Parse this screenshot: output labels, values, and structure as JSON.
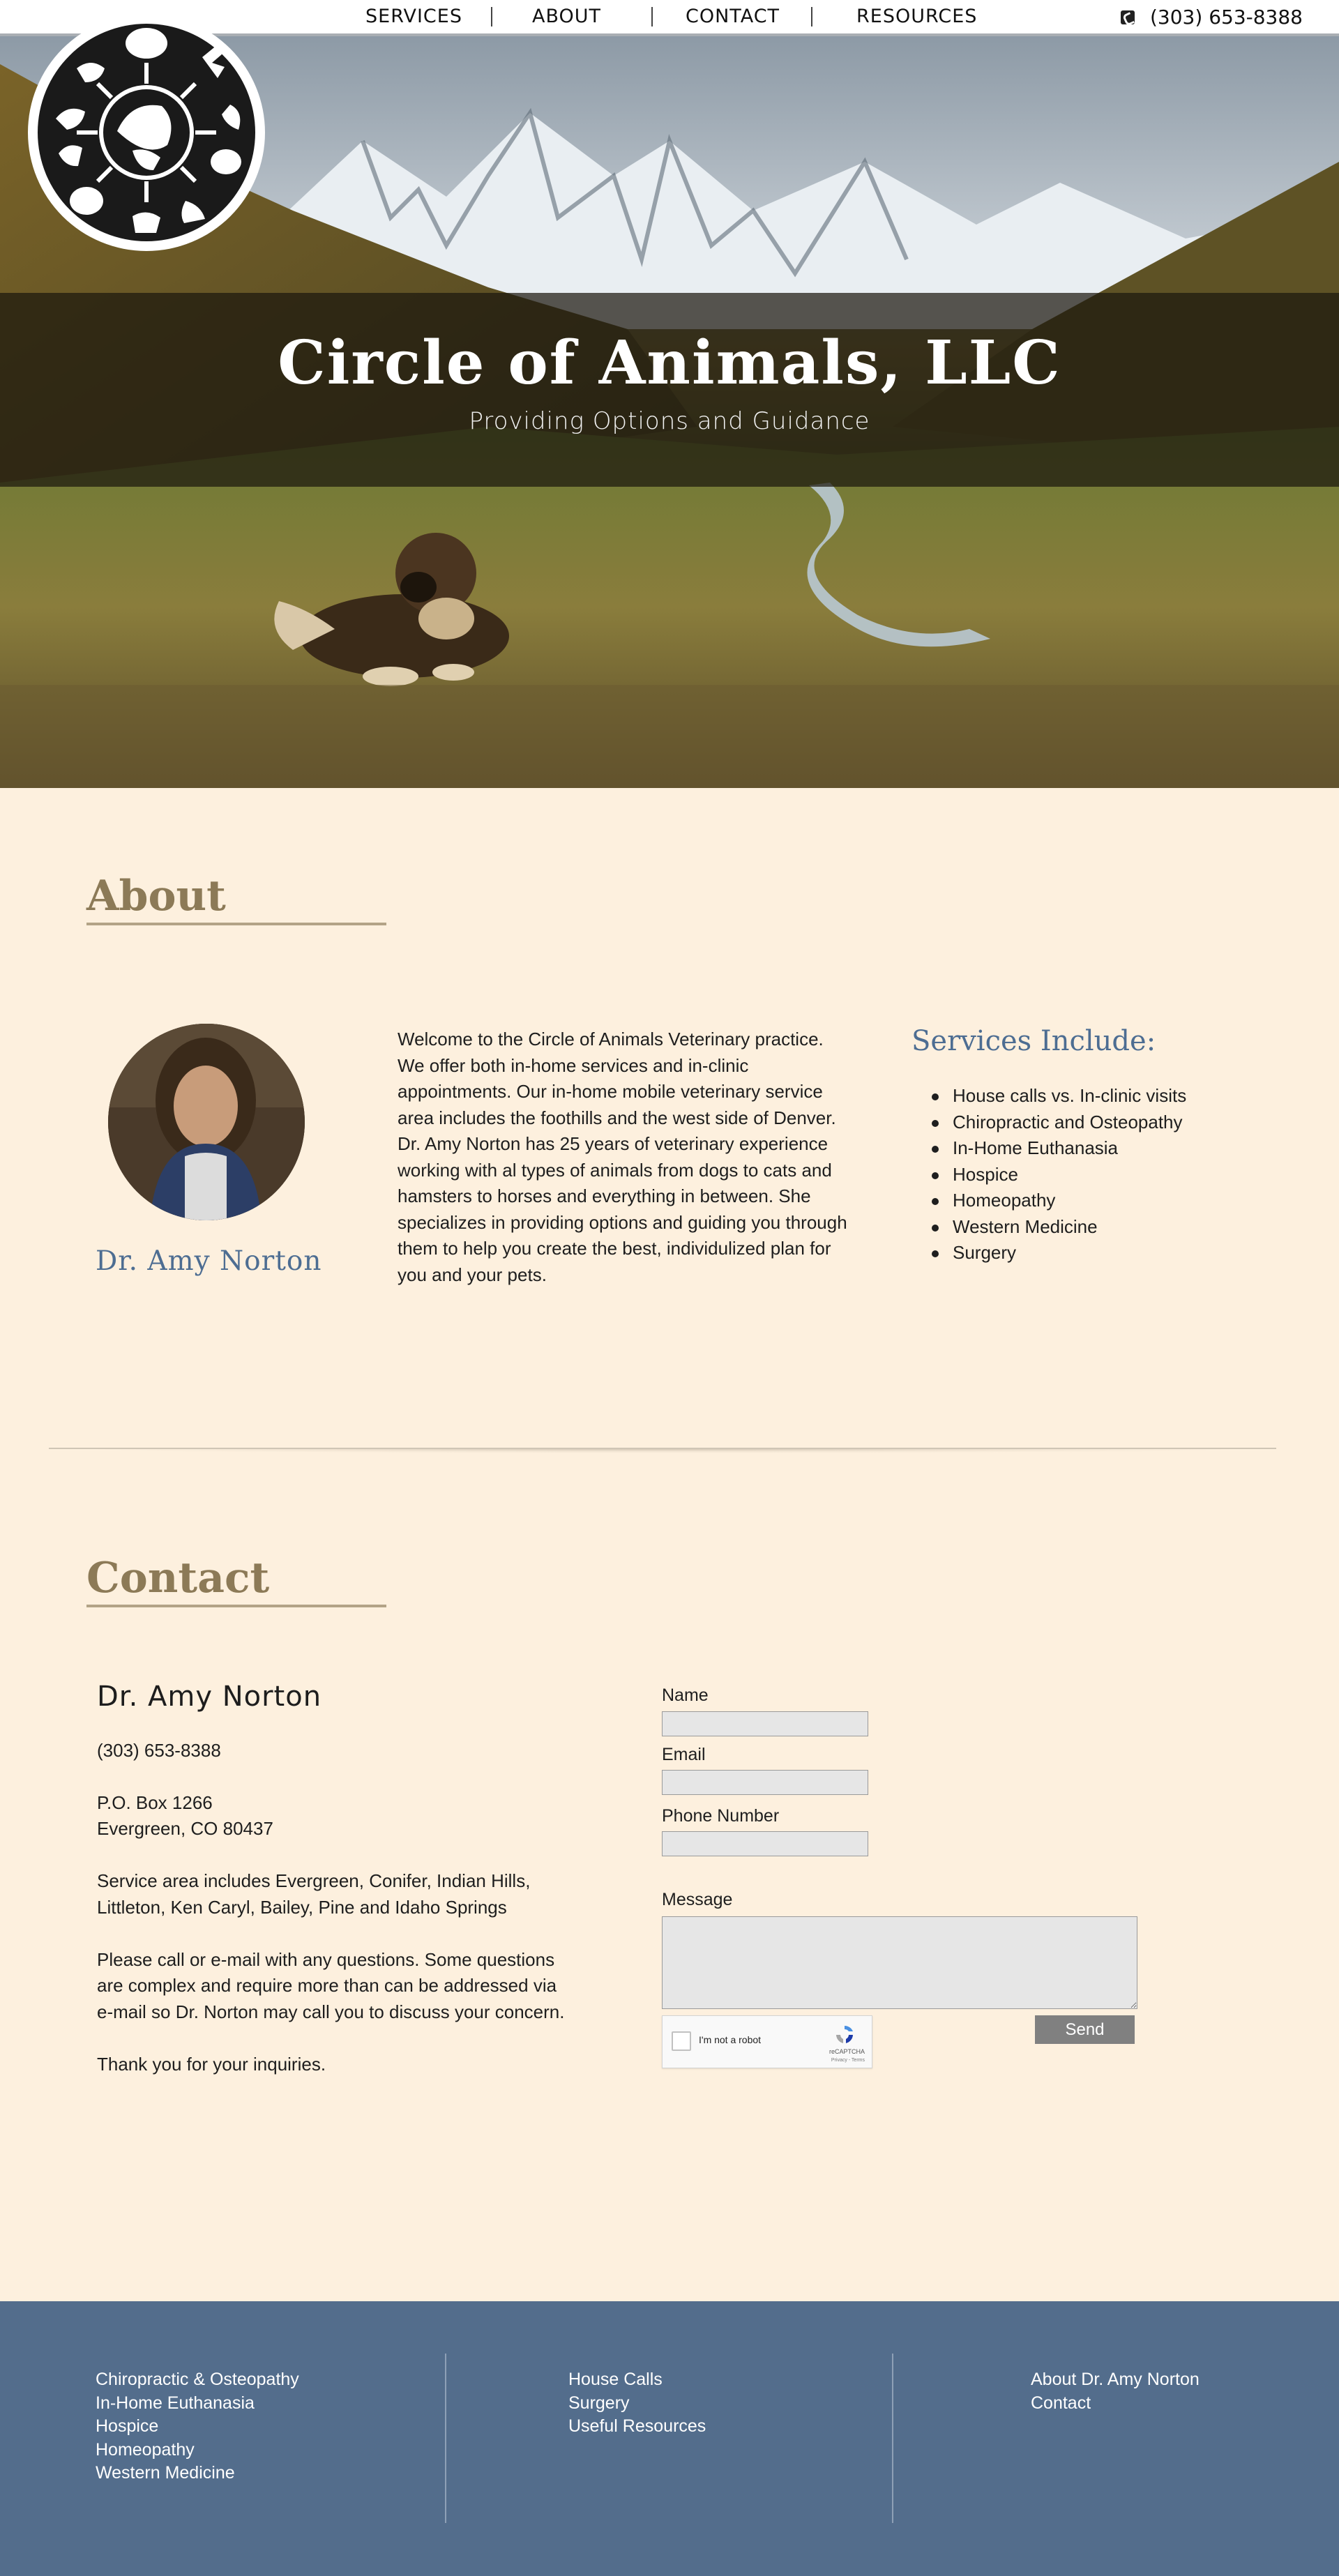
{
  "nav": {
    "items": [
      "SERVICES",
      "ABOUT",
      "CONTACT",
      "RESOURCES"
    ],
    "phone": "(303) 653-8388"
  },
  "hero": {
    "title": "Circle of Animals, LLC",
    "subtitle": "Providing Options and Guidance"
  },
  "about": {
    "heading": "About",
    "doctor_name": "Dr. Amy Norton",
    "intro_lines": [
      "Welcome to the Circle of Animals Veterinary practice.",
      "We offer both in-home services and in-clinic",
      "appointments. Our in-home mobile veterinary service",
      "area includes the foothills and the west side of Denver.",
      "Dr. Amy Norton has 25 years of veterinary experience",
      "working with al types of animals from dogs to cats and",
      "hamsters to horses and everything in between. She",
      "specializes in providing options and guiding you through",
      "them to help you create the best, individulized plan for",
      "you and your pets."
    ],
    "services_title": "Services Include:",
    "services": [
      "House calls vs. In-clinic visits",
      "Chiropractic and Osteopathy",
      "In-Home Euthanasia",
      "Hospice",
      "Homeopathy",
      "Western Medicine",
      "Surgery"
    ]
  },
  "contact": {
    "heading": "Contact",
    "name": "Dr. Amy Norton",
    "phone": "(303) 653-8388",
    "address_1": "P.O. Box 1266",
    "address_2": "Evergreen, CO 80437",
    "service_area_1": "Service area includes Evergreen, Conifer, Indian Hills,",
    "service_area_2": "Littleton, Ken Caryl, Bailey, Pine and Idaho Springs",
    "note_1": "Please call or e-mail with any questions. Some questions",
    "note_2": "are complex and require more than can be addressed via",
    "note_3": "e-mail so Dr. Norton may call you to discuss your concern.",
    "thanks": "Thank you for your inquiries.",
    "form": {
      "name_label": "Name",
      "email_label": "Email",
      "phone_label": "Phone Number",
      "message_label": "Message",
      "recaptcha_label": "I'm not a robot",
      "recaptcha_brand": "reCAPTCHA",
      "recaptcha_terms": "Privacy - Terms",
      "send_label": "Send"
    }
  },
  "footer": {
    "col1": [
      "Chiropractic & Osteopathy",
      "In-Home Euthanasia",
      "Hospice",
      "Homeopathy",
      "Western Medicine"
    ],
    "col2": [
      "House Calls",
      "Surgery",
      "Useful Resources"
    ],
    "col3": [
      "About Dr. Amy Norton",
      "Contact"
    ]
  },
  "colors": {
    "page_background": "#fdf0de",
    "heading_brown": "#8c7a57",
    "accent_blue": "#4d6d92",
    "footer_blue": "#536d8c"
  }
}
